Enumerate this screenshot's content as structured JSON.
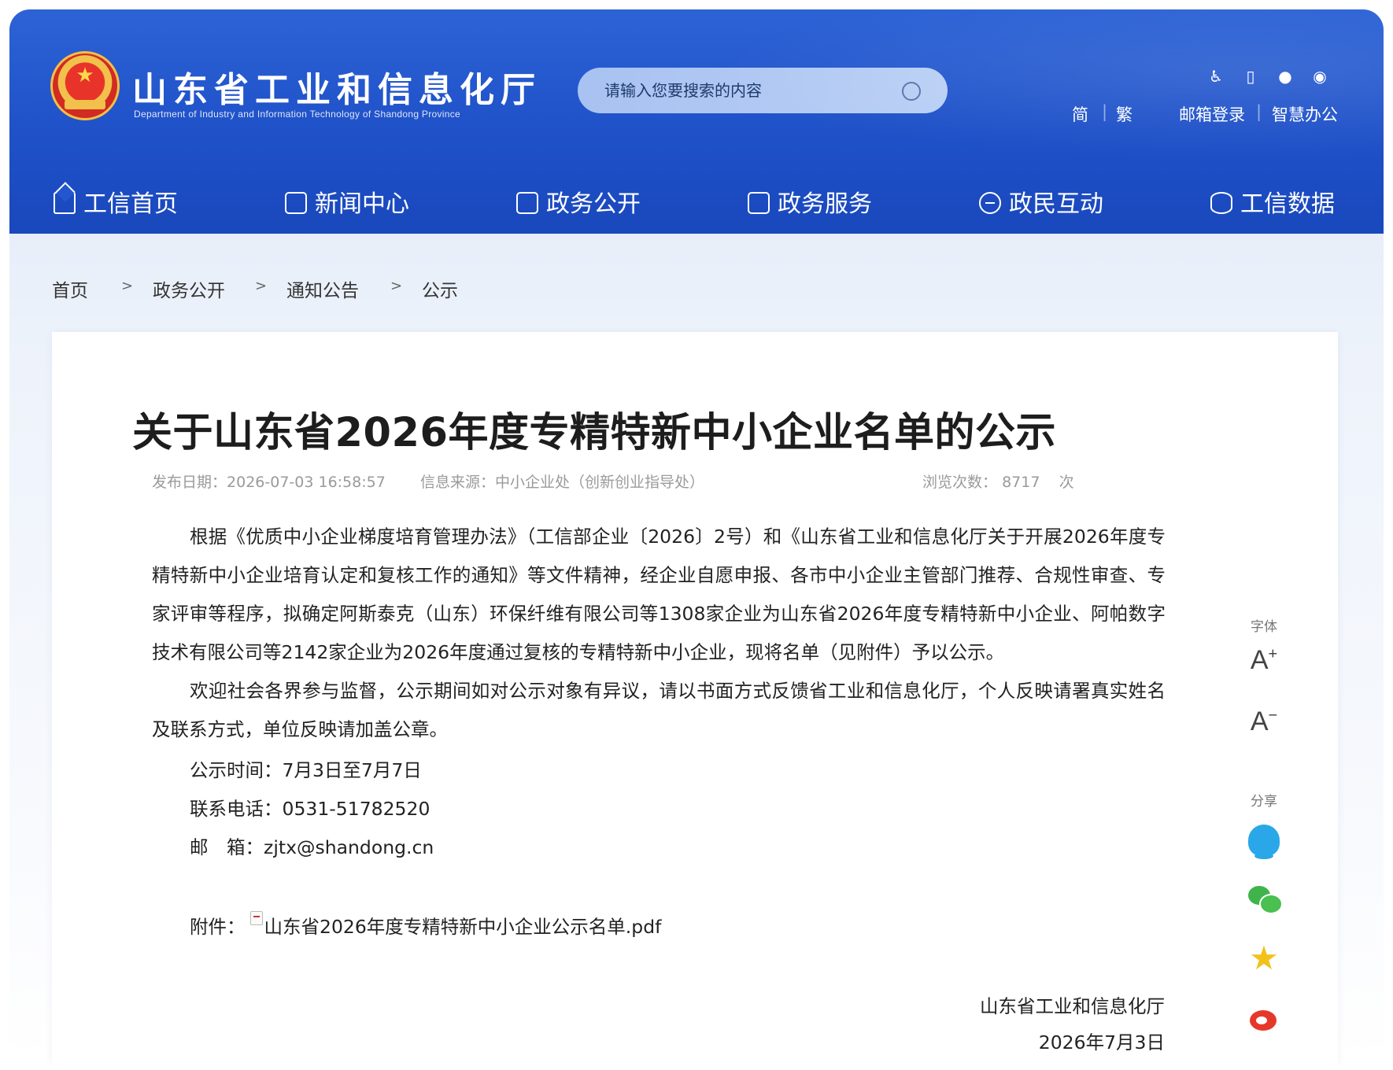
{
  "header": {
    "title": "山东省工业和信息化厅",
    "subtitle": "Department of Industry and Information Technology of Shandong Province",
    "search_placeholder": "请输入您要搜索的内容",
    "top_links": [
      "简",
      "繁",
      "邮箱登录",
      "智慧办公"
    ],
    "top_icons": [
      "accessibility-icon",
      "mobile-icon",
      "wechat-icon",
      "weibo-icon"
    ]
  },
  "nav": [
    {
      "label": "工信首页",
      "icon": "home-icon"
    },
    {
      "label": "新闻中心",
      "icon": "document-icon"
    },
    {
      "label": "政务公开",
      "icon": "monitor-icon"
    },
    {
      "label": "政务服务",
      "icon": "service-icon"
    },
    {
      "label": "政民互动",
      "icon": "chat-icon"
    },
    {
      "label": "工信数据",
      "icon": "database-icon"
    }
  ],
  "breadcrumb": [
    "首页",
    "政务公开",
    "通知公告",
    "公示"
  ],
  "breadcrumb_sep": ">",
  "article": {
    "title": "关于山东省2026年度专精特新中小企业名单的公示",
    "meta": {
      "date_label": "发布日期：",
      "date": "2026-07-03 16:58:57",
      "source_label": "信息来源：",
      "source": "中小企业处（创新创业指导处）",
      "views_label": "浏览次数：",
      "views": "8717",
      "views_unit": "次"
    },
    "paragraphs": [
      "根据《优质中小企业梯度培育管理办法》（工信部企业〔2026〕2号）和《山东省工业和信息化厅关于开展2026年度专精特新中小企业培育认定和复核工作的通知》等文件精神，经企业自愿申报、各市中小企业主管部门推荐、合规性审查、专家评审等程序，拟确定阿斯泰克（山东）环保纤维有限公司等1308家企业为山东省2026年度专精特新中小企业、阿帕数字技术有限公司等2142家企业为2026年度通过复核的专精特新中小企业，现将名单（见附件）予以公示。",
      "欢迎社会各界参与监督，公示期间如对公示对象有异议，请以书面方式反馈省工业和信息化厅，个人反映请署真实姓名及联系方式，单位反映请加盖公章。"
    ],
    "period": "公示时间：7月3日至7月7日",
    "phone": "联系电话：0531-51782520",
    "email": "邮　箱：zjtx@shandong.cn",
    "attachment_label": "附件：",
    "attachment_file": "山东省2026年度专精特新中小企业公示名单.pdf",
    "signature_org": "山东省工业和信息化厅",
    "signature_date": "2026年7月3日"
  },
  "side": {
    "font_label": "字体",
    "font_increase": "A+",
    "font_decrease": "A−",
    "share_label": "分享",
    "share_icons": [
      "qq-icon",
      "wechat-icon",
      "favorite-star-icon",
      "weibo-icon"
    ]
  },
  "colors": {
    "header_blue": "#1f51c8",
    "search_bg": "#b0c8f3",
    "page_bg": "#eef3fb"
  }
}
